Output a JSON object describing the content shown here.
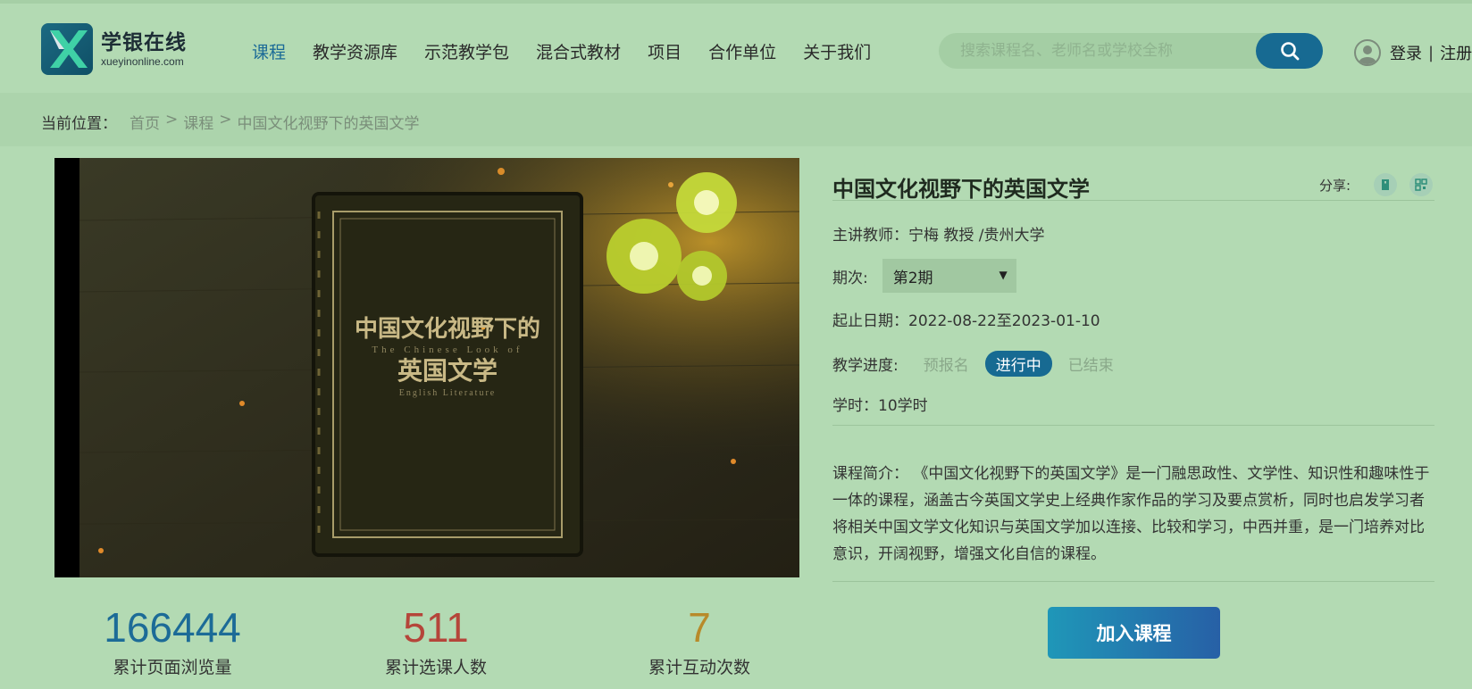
{
  "header": {
    "logo_cn": "学银在线",
    "logo_en": "xueyinonline.com",
    "nav": [
      "课程",
      "教学资源库",
      "示范教学包",
      "混合式教材",
      "项目",
      "合作单位",
      "关于我们"
    ],
    "search_placeholder": "搜索课程名、老师名或学校全称",
    "login": "登录",
    "separator": "|",
    "register": "注册"
  },
  "breadcrumb": {
    "label": "当前位置：",
    "items": [
      "首页",
      "课程",
      "中国文化视野下的英国文学"
    ],
    "sep": ">"
  },
  "video": {
    "cover_title": "中国文化视野下的",
    "cover_subtitle_en": "The Chinese Look of",
    "cover_title2": "英国文学",
    "cover_caption_en": "English Literature"
  },
  "course": {
    "title": "中国文化视野下的英国文学",
    "share_label": "分享:",
    "teacher": "主讲教师：宁梅 教授 /贵州大学",
    "term_label": "期次:",
    "term_value": "第2期",
    "dates": "起止日期：2022-08-22至2023-01-10",
    "progress_label": "教学进度:",
    "progress_steps": [
      "预报名",
      "进行中",
      "已结束"
    ],
    "hours": "学时：10学时",
    "intro": "课程简介：  《中国文化视野下的英国文学》是一门融思政性、文学性、知识性和趣味性于一体的课程，涵盖古今英国文学史上经典作家作品的学习及要点赏析，同时也启发学习者将相关中国文学文化知识与英国文学加以连接、比较和学习，中西并重，是一门培养对比意识，开阔视野，增强文化自信的课程。",
    "join_button": "加入课程"
  },
  "stats": [
    {
      "value": "166444",
      "label": "累计页面浏览量",
      "color": "#1c6b97"
    },
    {
      "value": "511",
      "label": "累计选课人数",
      "color": "#b5453a"
    },
    {
      "value": "7",
      "label": "累计互动次数",
      "color": "#b88a2a"
    }
  ],
  "colors": {
    "background": "#b3dab3",
    "accent": "#176a92"
  }
}
